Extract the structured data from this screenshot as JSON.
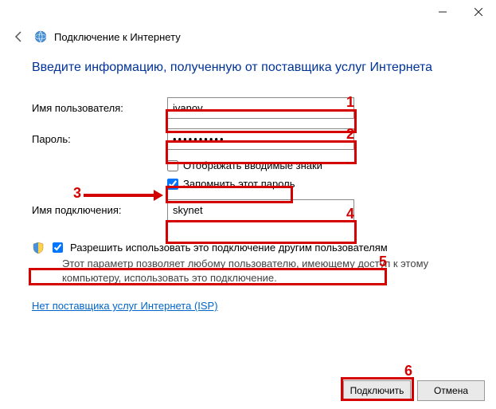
{
  "window": {
    "title": "Подключение к Интернету"
  },
  "heading": "Введите информацию, полученную от поставщика услуг Интернета",
  "form": {
    "username_label": "Имя пользователя:",
    "username_value": "ivanov",
    "password_label": "Пароль:",
    "password_value": "••••••••••",
    "show_chars_label": "Отображать вводимые знаки",
    "remember_label": "Запомнить этот пароль",
    "conn_name_label": "Имя подключения:",
    "conn_name_value": "skynet"
  },
  "allow": {
    "label": "Разрешить использовать это подключение другим пользователям",
    "desc": "Этот параметр позволяет любому пользователю, имеющему доступ к этому компьютеру, использовать это подключение."
  },
  "link_text": "Нет поставщика услуг Интернета (ISP)",
  "buttons": {
    "connect": "Подключить",
    "cancel": "Отмена"
  },
  "annotations": {
    "n1": "1",
    "n2": "2",
    "n3": "3",
    "n4": "4",
    "n5": "5",
    "n6": "6"
  }
}
